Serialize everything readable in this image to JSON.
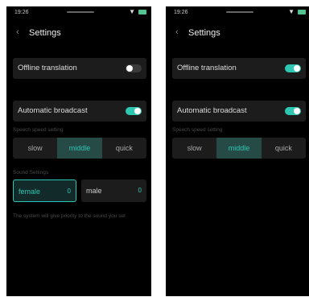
{
  "status": {
    "time": "19:26"
  },
  "header": {
    "title": "Settings"
  },
  "settings": {
    "offline_translation": {
      "label": "Offline translation",
      "enabled": false
    },
    "automatic_broadcast": {
      "label": "Automatic broadcast",
      "enabled": true
    },
    "speech_speed": {
      "label": "Speech speed setting",
      "options": [
        "slow",
        "middle",
        "quick"
      ],
      "selected": "middle"
    },
    "sound": {
      "label": "Sound Settings",
      "options": [
        {
          "label": "female",
          "count": "0"
        },
        {
          "label": "male",
          "count": "0"
        }
      ],
      "selected": "female",
      "note": "The system will give priority to the sound you set"
    }
  },
  "colors": {
    "accent": "#2ec7b1",
    "background": "#000000",
    "row": "#1c1c1c"
  },
  "icons": {
    "back": "chevron-left-icon",
    "wifi": "wifi-icon",
    "battery": "battery-icon"
  }
}
